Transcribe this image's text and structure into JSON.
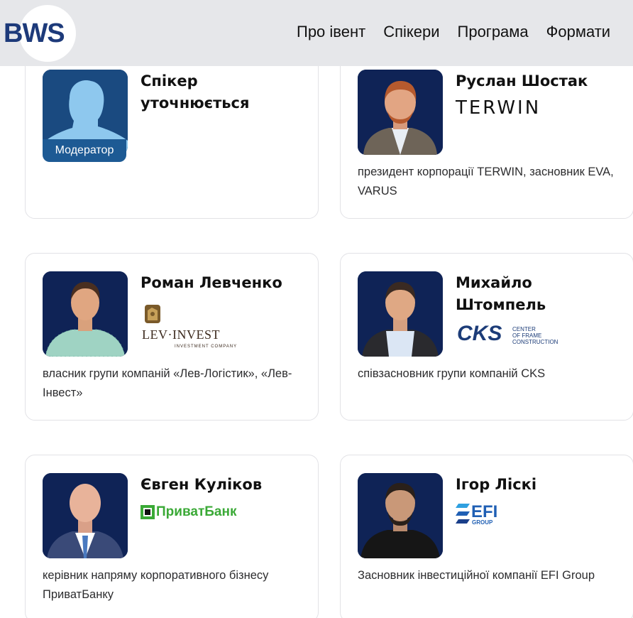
{
  "header": {
    "logo_text": "BWS",
    "nav": [
      "Про івент",
      "Спікери",
      "Програма",
      "Формати"
    ]
  },
  "speakers": [
    {
      "name": "Спікер уточнюється",
      "badge": "Модератор",
      "description": ""
    },
    {
      "name": "Руслан Шостак",
      "company_logo": "TERWIN",
      "description": "президент корпорації TERWIN, засновник EVA, VARUS"
    },
    {
      "name": "Роман Левченко",
      "company_logo": "LEV·INVEST",
      "company_logo_sub": "INVESTMENT COMPANY",
      "description": "власник групи компаній «Лев-Логістик», «Лев-Інвест»"
    },
    {
      "name": "Михайло Штомпель",
      "company_logo": "CKS",
      "company_logo_sub": [
        "CENTER",
        "OF FRAME",
        "CONSTRUCTION"
      ],
      "description": "співзасновник групи компаній CKS"
    },
    {
      "name": "Євген Куліков",
      "company_logo": "ПриватБанк",
      "description": "керівник напряму корпоративного бізнесу ПриватБанку"
    },
    {
      "name": "Ігор Ліскі",
      "company_logo": "EFI",
      "company_logo_sub": "GROUP",
      "description": "Засновник інвестиційної компанії EFI Group"
    }
  ],
  "colors": {
    "header_bg": "#e6e7ea",
    "photo_bg": "#10255a",
    "badge_bg": "#1d5a94",
    "logo_blue": "#1d3a7a"
  },
  "icons": [
    "bws-logo",
    "avatar-placeholder-icon",
    "terwin-logo",
    "lev-invest-logo",
    "cks-logo",
    "privatbank-logo",
    "efi-group-logo"
  ]
}
